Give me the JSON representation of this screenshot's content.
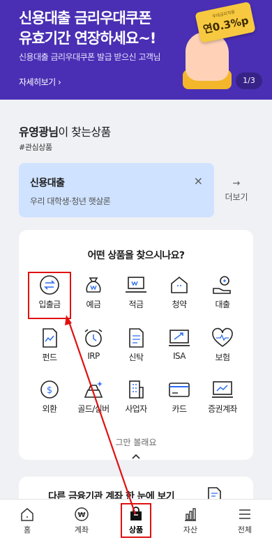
{
  "banner": {
    "title_line1": "신용대출 금리우대쿠폰",
    "title_line2": "유효기간 연장하세요~!",
    "subtitle": "신용대출 금리우대쿠폰 발급 받으신 고객님",
    "more_label": "자세히보기 ›",
    "page_indicator": "1/3",
    "coupon_small": "우대금리적용",
    "coupon_rate": "연0.3%p",
    "bg_color": "#4a2fb4"
  },
  "recommend": {
    "user_name": "유영광님",
    "title_rest": "이 찾는상품",
    "tag": "#관심상품",
    "card_name": "신용대출",
    "card_desc": "우리 대학생·청년 햇살론",
    "close_icon": "×",
    "more_label": "더보기",
    "more_arrow": "→"
  },
  "products": {
    "question": "어떤 상품을 찾으시나요?",
    "categories": [
      {
        "label": "입출금",
        "icon": "transfer-icon"
      },
      {
        "label": "예금",
        "icon": "money-bag-icon"
      },
      {
        "label": "적금",
        "icon": "laptop-icon"
      },
      {
        "label": "청약",
        "icon": "house-icon"
      },
      {
        "label": "대출",
        "icon": "hand-money-icon"
      },
      {
        "label": "펀드",
        "icon": "chart-document-icon"
      },
      {
        "label": "IRP",
        "icon": "alarm-clock-icon"
      },
      {
        "label": "신탁",
        "icon": "document-icon"
      },
      {
        "label": "ISA",
        "icon": "trend-monitor-icon"
      },
      {
        "label": "보험",
        "icon": "heart-icon"
      },
      {
        "label": "외환",
        "icon": "dollar-coin-icon"
      },
      {
        "label": "골드/실버",
        "icon": "gold-bar-icon"
      },
      {
        "label": "사업자",
        "icon": "building-icon"
      },
      {
        "label": "카드",
        "icon": "card-icon"
      },
      {
        "label": "증권계좌",
        "icon": "stock-monitor-icon"
      }
    ],
    "collapse_label": "그만 볼래요"
  },
  "teaser": {
    "text": "다른 금융기관 계좌 한 눈에 보기"
  },
  "nav": {
    "items": [
      {
        "label": "홈"
      },
      {
        "label": "계좌"
      },
      {
        "label": "상품"
      },
      {
        "label": "자산"
      },
      {
        "label": "전체"
      }
    ],
    "active": "상품"
  },
  "annotation_color": "#e01010"
}
